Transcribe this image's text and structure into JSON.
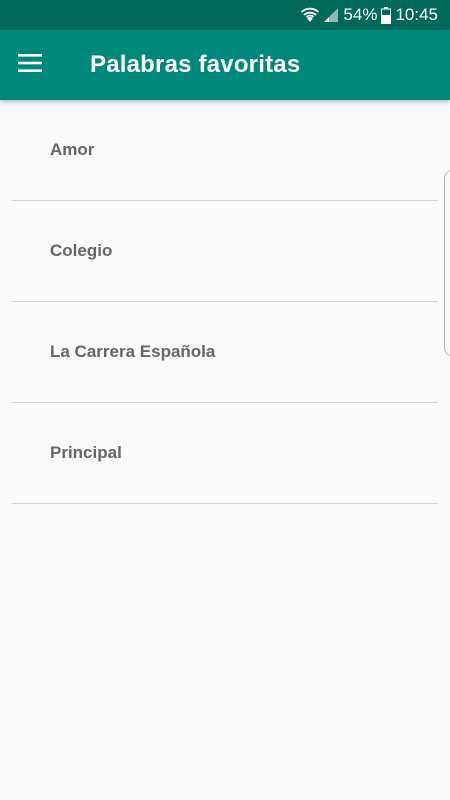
{
  "status_bar": {
    "battery_percent": "54%",
    "time": "10:45",
    "icons": [
      "wifi-icon",
      "signal-icon",
      "battery-icon"
    ]
  },
  "app_bar": {
    "title": "Palabras favoritas",
    "menu_icon": "hamburger-menu-icon"
  },
  "favorites": [
    {
      "label": "Amor"
    },
    {
      "label": "Colegio"
    },
    {
      "label": "La Carrera Española"
    },
    {
      "label": "Principal"
    }
  ],
  "colors": {
    "status_bar": "#00695c",
    "app_bar": "#00897b",
    "background": "#fafafa",
    "item_text": "#666666",
    "divider": "#d6d6d6"
  }
}
